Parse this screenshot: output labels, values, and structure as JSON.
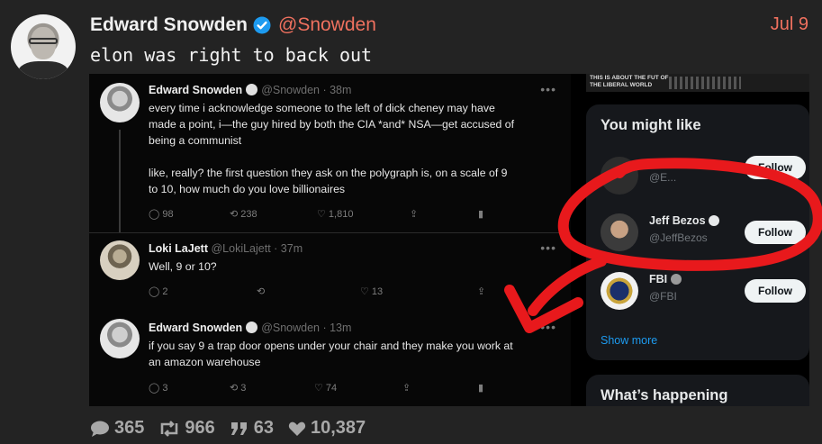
{
  "post": {
    "author": "Edward Snowden",
    "handle": "@Snowden",
    "date": "Jul 9",
    "text": "elon was right to back out"
  },
  "embedded": {
    "tweets": [
      {
        "name": "Edward Snowden",
        "meta": "@Snowden · 38m",
        "text_lines": [
          "every time i acknowledge someone to the left of dick cheney may have",
          "made a point, i—the guy hired by both the CIA *and* NSA—get accused of",
          "being a communist",
          "",
          "like, really? the first question they ask on the polygraph is, on a scale of 9",
          "to 10, how much do you love billionaires"
        ],
        "replies": "98",
        "retweets": "238",
        "likes": "1,810"
      },
      {
        "name": "Loki LaJett",
        "meta": "@LokiLajett · 37m",
        "text_lines": [
          "Well, 9 or 10?"
        ],
        "replies": "2",
        "retweets": "",
        "likes": "13"
      },
      {
        "name": "Edward Snowden",
        "meta": "@Snowden · 13m",
        "text_lines": [
          "if you say 9 a trap door opens under your chair and they make you work at",
          "an amazon warehouse"
        ],
        "replies": "3",
        "retweets": "3",
        "likes": "74"
      }
    ],
    "sidebar": {
      "banner_text": "THIS IS ABOUT THE FUT OF THE LIBERAL WORLD",
      "you_might_like": "You might like",
      "accounts": [
        {
          "name": "",
          "handle": "@E...",
          "follow": "Follow"
        },
        {
          "name": "Jeff Bezos",
          "handle": "@JeffBezos",
          "follow": "Follow"
        },
        {
          "name": "FBI",
          "handle": "@FBI",
          "follow": "Follow"
        }
      ],
      "show_more": "Show more",
      "whats_happening": "What’s happening"
    }
  },
  "stats": {
    "replies": "365",
    "retweets": "966",
    "quotes": "63",
    "likes": "10,387"
  },
  "colors": {
    "accent": "#f0715f",
    "background": "#232323",
    "annotation_red": "#e8191c",
    "twitter_blue": "#1d9bf0"
  }
}
